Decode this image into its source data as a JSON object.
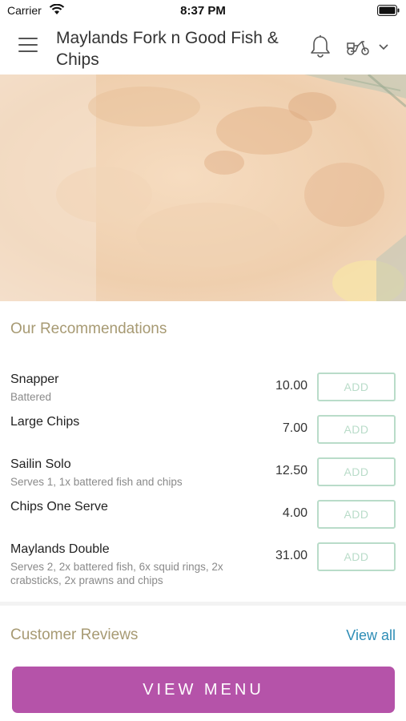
{
  "status_bar": {
    "carrier": "Carrier",
    "time": "8:37 PM"
  },
  "header": {
    "title": "Maylands Fork n Good Fish & Chips",
    "icons": [
      "menu-icon",
      "bell-icon",
      "scooter-icon",
      "chevron-down-icon"
    ]
  },
  "recommendations": {
    "heading": "Our Recommendations",
    "items": [
      {
        "name": "Snapper",
        "desc": "Battered",
        "price": "10.00",
        "add_label": "ADD"
      },
      {
        "name": "Large Chips",
        "desc": "",
        "price": "7.00",
        "add_label": "ADD"
      },
      {
        "name": "Sailin Solo",
        "desc": "Serves 1, 1x battered fish and chips",
        "price": "12.50",
        "add_label": "ADD"
      },
      {
        "name": "Chips One Serve",
        "desc": "",
        "price": "4.00",
        "add_label": "ADD"
      },
      {
        "name": "Maylands Double",
        "desc": "Serves 2, 2x battered fish, 6x squid rings, 2x crabsticks, 2x prawns and chips",
        "price": "31.00",
        "add_label": "ADD"
      }
    ]
  },
  "reviews": {
    "heading": "Customer Reviews",
    "view_all": "View all"
  },
  "view_menu_label": "VIEW MENU",
  "colors": {
    "accent_purple": "#b553a9",
    "heading_gold": "#a79a73",
    "add_green": "#b9dcc9",
    "link_blue": "#2e8db6"
  }
}
